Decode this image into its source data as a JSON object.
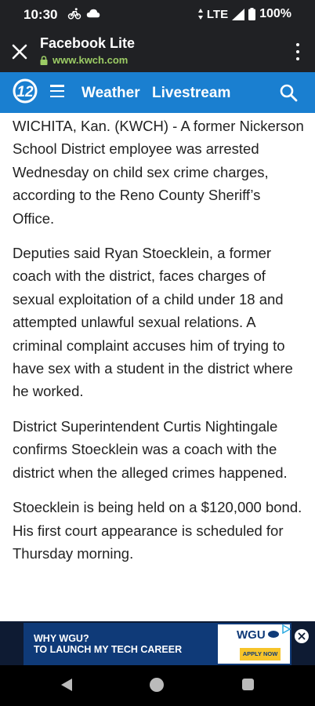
{
  "status_bar": {
    "time": "10:30",
    "network": "LTE",
    "battery": "100%"
  },
  "app_bar": {
    "title": "Facebook Lite",
    "url": "www.kwch.com"
  },
  "site_nav": {
    "logo_text": "12",
    "links": [
      "Weather",
      "Livestream"
    ]
  },
  "article": {
    "paragraphs": [
      "WICHITA, Kan. (KWCH) - A former Nickerson School District employee was arrested Wednesday on child sex crime charges, according to the Reno County Sheriff’s Office.",
      "Deputies said Ryan Stoecklein, a former coach with the district, faces charges of sexual exploitation of a child under 18 and attempted unlawful sexual relations. A criminal complaint accuses him of trying to have sex with a student in the district where he worked.",
      "District Superintendent Curtis Nightingale confirms Stoecklein was a coach with the district when the alleged crimes happened.",
      "Stoecklein is being held on a $120,000 bond. His first court appearance is scheduled for Thursday morning."
    ]
  },
  "ad": {
    "line1": "WHY WGU?",
    "line2": "TO LAUNCH MY TECH CAREER",
    "brand": "WGU",
    "cta": "APPLY NOW"
  },
  "colors": {
    "chrome": "#202124",
    "site_nav": "#1a7fd0",
    "url_green": "#9ccc65"
  }
}
